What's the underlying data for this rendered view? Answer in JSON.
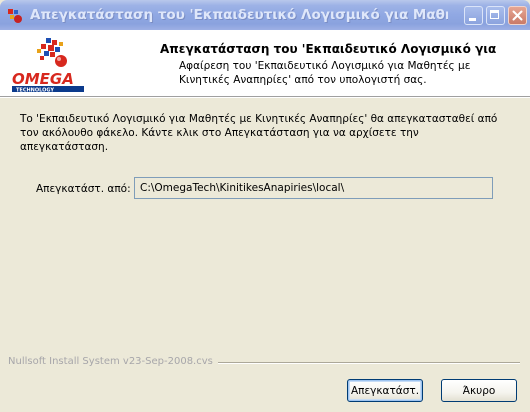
{
  "window": {
    "title": "Απεγκατάσταση του 'Εκπαιδευτικό Λογισμικό για Μαθητές με Κι..."
  },
  "header": {
    "title": "Απεγκατάσταση του 'Εκπαιδευτικό Λογισμικό για",
    "subtitle": "Αφαίρεση του 'Εκπαιδευτικό Λογισμικό για Μαθητές με Κινητικές Αναπηρίες' από τον υπολογιστή σας.",
    "logo_text": "OMEGA",
    "logo_subtext": "TECHNOLOGY"
  },
  "body": {
    "intro": "Το 'Εκπαιδευτικό Λογισμικό για Μαθητές με Κινητικές Αναπηρίες' θα απεγκατασταθεί από τον ακόλουθο φάκελο. Κάντε κλικ στο Απεγκατάσταση για να αρχίσετε την απεγκατάσταση.",
    "dest_label": "Απεγκατάστ. από:",
    "dest_value": "C:\\OmegaTech\\KinitikesAnapiries\\local\\"
  },
  "footer": {
    "branding": "Nullsoft Install System v23-Sep-2008.cvs",
    "uninstall_label": "Απεγκατάστ.",
    "cancel_label": "Άκυρο"
  },
  "colors": {
    "logo_red": "#d7281e",
    "logo_blue": "#0b3a8c",
    "dialog_bg": "#ece9d8"
  },
  "icons": {
    "app": "installer-app-icon",
    "minimize": "minimize-icon",
    "maximize": "maximize-icon",
    "close": "close-icon"
  }
}
